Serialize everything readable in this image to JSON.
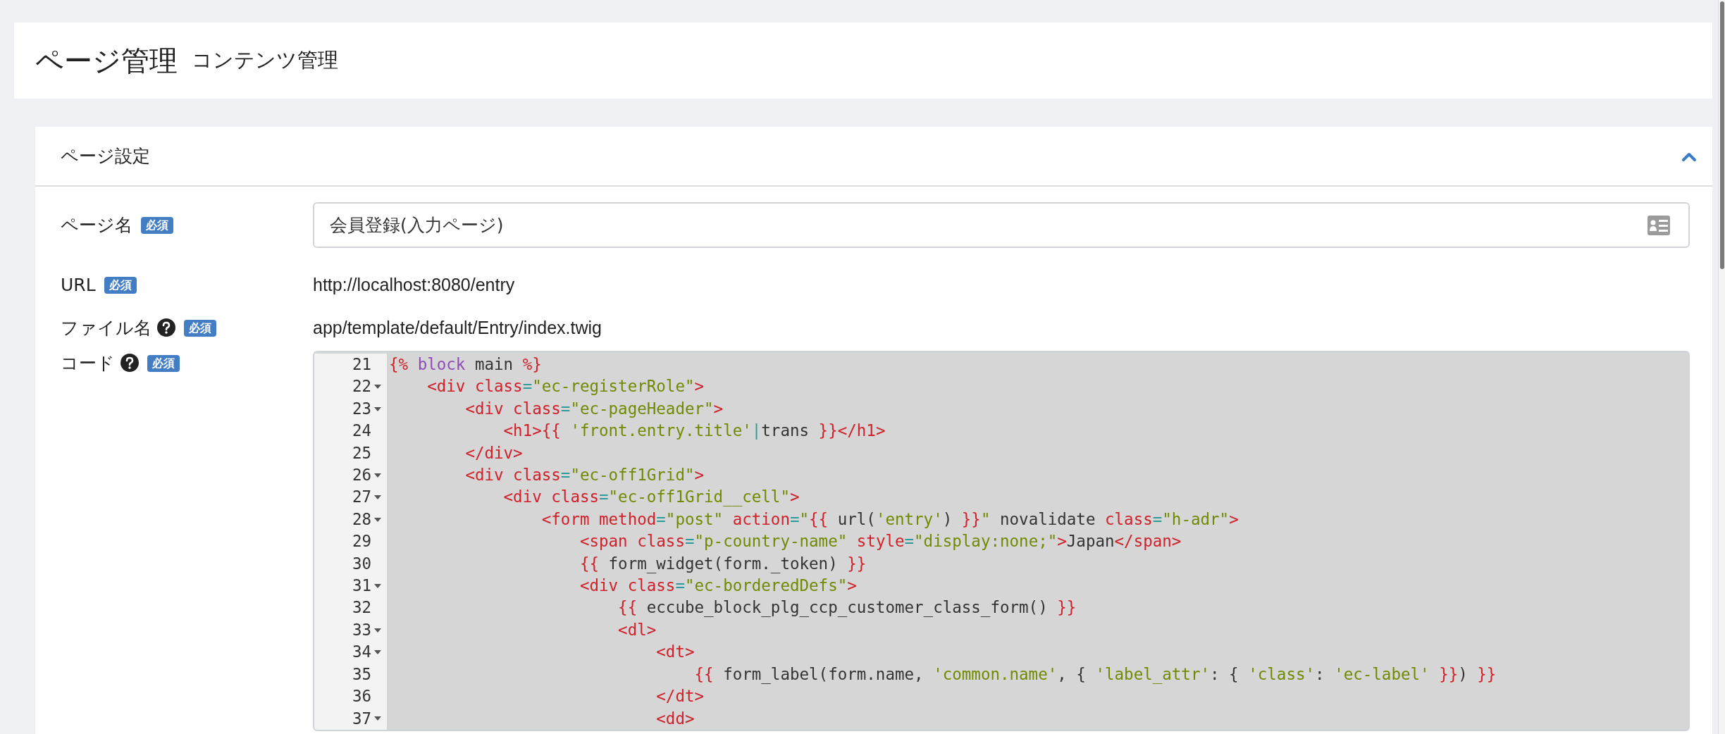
{
  "header": {
    "title": "ページ管理",
    "subtitle": "コンテンツ管理"
  },
  "card": {
    "title": "ページ設定",
    "expanded": true,
    "fields": [
      {
        "label": "ページ名",
        "help": false,
        "badge": "必須",
        "kind": "input",
        "value": "会員登録(入力ページ)"
      },
      {
        "label": "URL",
        "help": false,
        "badge": "必須",
        "kind": "text",
        "value": "http://localhost:8080/entry"
      },
      {
        "label": "ファイル名",
        "help": true,
        "badge": "必須",
        "kind": "text",
        "value": "app/template/default/Entry/index.twig"
      },
      {
        "label": "コード",
        "help": true,
        "badge": "必須",
        "kind": "code"
      }
    ]
  },
  "code_lines": [
    {
      "number": "21",
      "foldable": false,
      "text": "{% block main %}"
    },
    {
      "number": "22",
      "foldable": true,
      "text": "    <div class=\"ec-registerRole\">"
    },
    {
      "number": "23",
      "foldable": true,
      "text": "        <div class=\"ec-pageHeader\">"
    },
    {
      "number": "24",
      "foldable": false,
      "text": "            <h1>{{ 'front.entry.title'|trans }}</h1>"
    },
    {
      "number": "25",
      "foldable": false,
      "text": "        </div>"
    },
    {
      "number": "26",
      "foldable": true,
      "text": "        <div class=\"ec-off1Grid\">"
    },
    {
      "number": "27",
      "foldable": true,
      "text": "            <div class=\"ec-off1Grid__cell\">"
    },
    {
      "number": "28",
      "foldable": true,
      "text": "                <form method=\"post\" action=\"{{ url('entry') }}\" novalidate class=\"h-adr\">"
    },
    {
      "number": "29",
      "foldable": false,
      "text": "                    <span class=\"p-country-name\" style=\"display:none;\">Japan</span>"
    },
    {
      "number": "30",
      "foldable": false,
      "text": "                    {{ form_widget(form._token) }}"
    },
    {
      "number": "31",
      "foldable": true,
      "text": "                    <div class=\"ec-borderedDefs\">"
    },
    {
      "number": "32",
      "foldable": false,
      "text": "                        {{ eccube_block_plg_ccp_customer_class_form() }}"
    },
    {
      "number": "33",
      "foldable": true,
      "text": "                        <dl>"
    },
    {
      "number": "34",
      "foldable": true,
      "text": "                            <dt>"
    },
    {
      "number": "35",
      "foldable": false,
      "text": "                                {{ form_label(form.name, 'common.name', { 'label_attr': { 'class': 'ec-label' }}) }}"
    },
    {
      "number": "36",
      "foldable": false,
      "text": "                            </dt>"
    },
    {
      "number": "37",
      "foldable": true,
      "text": "                            <dd>"
    }
  ]
}
